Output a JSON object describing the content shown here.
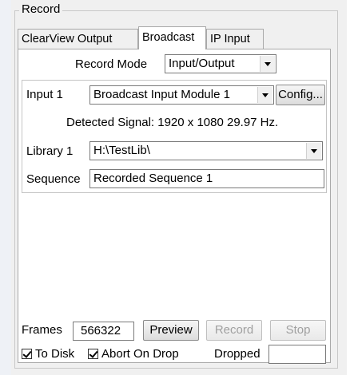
{
  "group": {
    "title": "Record"
  },
  "tabs": [
    "ClearView Output",
    "Broadcast",
    "IP Input"
  ],
  "active_tab": "Broadcast",
  "record_mode": {
    "label": "Record Mode",
    "value": "Input/Output"
  },
  "input": {
    "label": "Input 1",
    "value": "Broadcast Input Module 1",
    "config_label": "Config..."
  },
  "detected_signal": "Detected Signal: 1920 x 1080 29.97 Hz.",
  "library": {
    "label": "Library 1",
    "value": "H:\\TestLib\\"
  },
  "sequence": {
    "label": "Sequence",
    "value": "Recorded Sequence 1"
  },
  "frames": {
    "label": "Frames",
    "value": "566322"
  },
  "buttons": {
    "preview": "Preview",
    "record": "Record",
    "stop": "Stop"
  },
  "options": {
    "to_disk": "To Disk",
    "abort_on_drop": "Abort On Drop",
    "dropped_label": "Dropped",
    "dropped_value": ""
  }
}
